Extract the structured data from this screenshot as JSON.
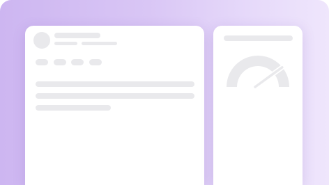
{
  "theme": {
    "background_start": "#cdb6f1",
    "background_end": "#efe6fc",
    "card": "#ffffff",
    "placeholder": "#e9e9ec"
  },
  "main_card": {
    "header_icons": [
      "avatar-placeholder"
    ],
    "tag_chip_count": 4,
    "text_line_count": 3
  },
  "side_card": {
    "icon": "speedometer-gauge-icon",
    "gauge_level": 0.8
  }
}
